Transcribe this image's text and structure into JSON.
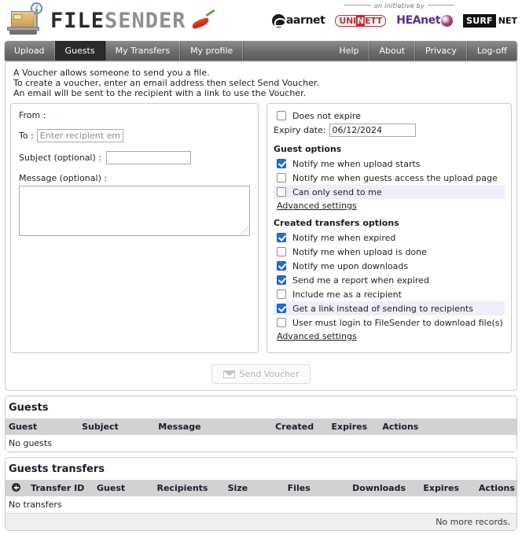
{
  "header": {
    "logo": {
      "icon_name": "package-scale-icon",
      "text_primary": "FILE",
      "text_secondary": "SENDER",
      "accent_icon": "chili-pepper-icon"
    },
    "sponsors": {
      "initiative_label": "on initiative by",
      "logos": [
        {
          "name": "aarnet",
          "text": "aarnet"
        },
        {
          "name": "uninett",
          "prefix": "UNI",
          "highlight": "N",
          "suffix": "ETT"
        },
        {
          "name": "heanet",
          "text": "HEAnet"
        },
        {
          "name": "surfnet",
          "boxed": "SURF",
          "plain": "NET"
        }
      ]
    }
  },
  "nav": {
    "left_items": [
      {
        "label": "Upload",
        "active": false
      },
      {
        "label": "Guests",
        "active": true
      },
      {
        "label": "My Transfers",
        "active": false
      },
      {
        "label": "My profile",
        "active": false
      }
    ],
    "right_items": [
      {
        "label": "Help"
      },
      {
        "label": "About"
      },
      {
        "label": "Privacy"
      },
      {
        "label": "Log-off"
      }
    ]
  },
  "intro": {
    "line1": "A Voucher allows someone to send you a file.",
    "line2": "To create a voucher, enter an email address then select Send Voucher.",
    "line3": "An email will be sent to the recipient with a link to use the Voucher."
  },
  "compose": {
    "from_label": "From :",
    "from_value": ".                    ·",
    "to_label": "To :",
    "to_placeholder": "Enter recipient email(s)",
    "to_value": "",
    "subject_label": "Subject (optional) :",
    "subject_value": "",
    "message_label": "Message (optional) :",
    "message_value": ""
  },
  "options": {
    "does_not_expire": {
      "label": "Does not expire",
      "checked": false
    },
    "expiry_label": "Expiry date:",
    "expiry_value": "06/12/2024",
    "guest_options_title": "Guest options",
    "guest_options": [
      {
        "label": "Notify me when upload starts",
        "checked": true,
        "highlighted": false
      },
      {
        "label": "Notify me when guests access the upload page",
        "checked": false,
        "highlighted": false
      },
      {
        "label": "Can only send to me",
        "checked": false,
        "highlighted": true
      }
    ],
    "guest_advanced_label": "Advanced settings",
    "transfers_options_title": "Created transfers options",
    "transfer_options": [
      {
        "label": "Notify me when expired",
        "checked": true,
        "highlighted": false
      },
      {
        "label": "Notify me when upload is done",
        "checked": false,
        "highlighted": false
      },
      {
        "label": "Notify me upon downloads",
        "checked": true,
        "highlighted": false
      },
      {
        "label": "Send me a report when expired",
        "checked": true,
        "highlighted": false
      },
      {
        "label": "Include me as a recipient",
        "checked": false,
        "highlighted": false
      },
      {
        "label": "Get a link instead of sending to recipients",
        "checked": true,
        "highlighted": true
      },
      {
        "label": "User must login to FileSender to download file(s)",
        "checked": false,
        "highlighted": false
      }
    ],
    "transfers_advanced_label": "Advanced settings"
  },
  "send_button": {
    "label": "Send Voucher",
    "icon": "envelope-icon",
    "disabled": true
  },
  "guests_table": {
    "title": "Guests",
    "columns": [
      "Guest",
      "Subject",
      "Message",
      "Created",
      "Expires",
      "Actions"
    ],
    "rows": [],
    "empty_message": "No guests"
  },
  "guests_transfers_table": {
    "title": "Guests transfers",
    "expand_icon": "expand-plus-icon",
    "columns": [
      "Transfer ID",
      "Guest",
      "Recipients",
      "Size",
      "Files",
      "Downloads",
      "Expires",
      "Actions"
    ],
    "rows": [],
    "empty_message": "No transfers",
    "footer_message": "No more records."
  },
  "colors": {
    "nav_active": "#2b2b2b",
    "checkbox_checked": "#1f6fd4",
    "row_highlight": "#eeeeff",
    "table_header": "#d2d2d2"
  }
}
